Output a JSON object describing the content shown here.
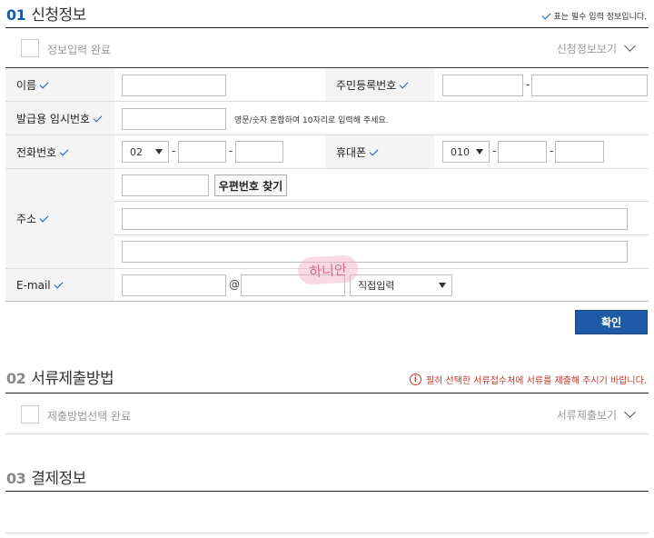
{
  "section1": {
    "num": "01",
    "title": "신청정보",
    "required_note": "표는 필수 입력 정보입니다.",
    "complete_label": "정보입력 완료",
    "view_toggle": "신청정보보기"
  },
  "form": {
    "name_label": "이름",
    "resident_label": "주민등록번호",
    "temp_number_label": "발급용 임시번호",
    "temp_number_hint": "영문/숫자 혼합하여 10자리로 입력해 주세요.",
    "phone_label": "전화번호",
    "phone_area": "02",
    "mobile_label": "휴대폰",
    "mobile_prefix": "010",
    "address_label": "주소",
    "postcode_button": "우편번호 찾기",
    "email_label": "E-mail",
    "email_at": "@",
    "email_domain_select": "직접입력",
    "dash": "-"
  },
  "confirm_button": "확인",
  "stamp_text": "하니안",
  "section2": {
    "num": "02",
    "title": "서류제출방법",
    "warning": "필히 선택한 서류접수처에 서류를 제출해 주시기 바랍니다.",
    "complete_label": "제출방법선택 완료",
    "view_toggle": "서류제출보기"
  },
  "section3": {
    "num": "03",
    "title": "결제정보"
  },
  "colors": {
    "accent": "#1a5aa8",
    "button": "#1f5aa6",
    "warning": "#c0392b"
  }
}
